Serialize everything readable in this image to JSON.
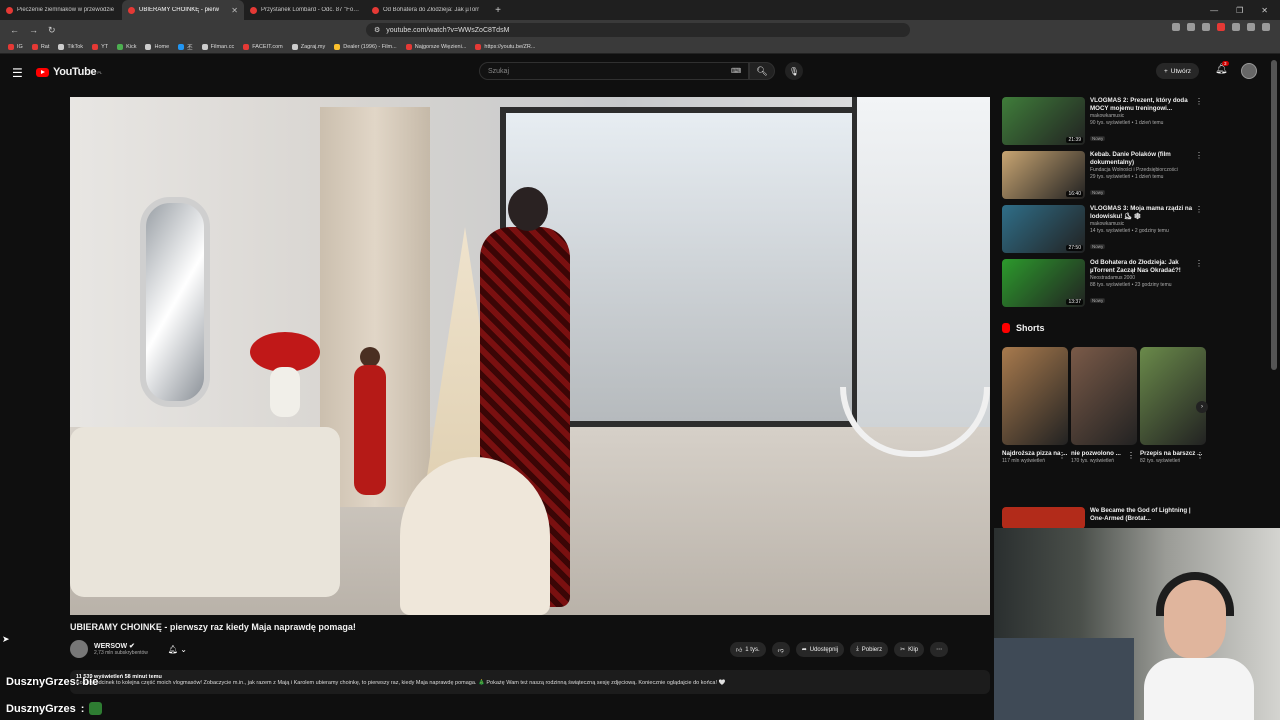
{
  "tabs": [
    {
      "label": "Pieczenie ziemniaków w przewodzie"
    },
    {
      "label": "UBIERAMY CHOINKĘ - pierw"
    },
    {
      "label": "Przystanek Lombard - Odc. 87 \"Forte"
    },
    {
      "label": "Od Bohatera do Złodzieja: Jak µTorr"
    }
  ],
  "browser": {
    "url": "youtube.com/watch?v=WWsZoC8TdsM",
    "bookmarks": [
      "IG",
      "Rat",
      "TikTok",
      "YT",
      "Kick",
      "Home",
      "丕",
      "Filman.cc",
      "FACEIT.com",
      "Zagraj.my",
      "Dealer (1996) - Film...",
      "Najgorsze Więzieni...",
      "https://youtu.be/ZR..."
    ]
  },
  "masthead": {
    "logo": "YouTube",
    "region": "PL",
    "search_placeholder": "Szukaj",
    "create_label": "Utwórz",
    "notif_count": "3"
  },
  "video": {
    "title": "UBIERAMY CHOINKĘ - pierwszy raz kiedy Maja naprawdę pomaga!",
    "channel": "WERSOW",
    "subs": "2,73 mln subskrybentów",
    "likes": "1 tys.",
    "share": "Udostępnij",
    "download": "Pobierz",
    "clip": "Klip",
    "desc_meta": "11 539 wyświetleń  58 minut temu",
    "desc_text": "Kolejny odcinek to kolejna część moich vlogmasów! Zobaczycie m.in., jak razem z Mają i Karolem ubieramy choinkę, to pierwszy raz, kiedy Maja naprawdę pomaga. 🎄 Pokażę Wam też naszą rodzinną świąteczną sesję zdjęciową. Koniecznie oglądajcie do końca! 🤍"
  },
  "chat": [
    {
      "user": "DusznyGrzes",
      "text": ": bie"
    },
    {
      "user": "DusznyGrzes",
      "text": ":"
    }
  ],
  "recommendations": [
    {
      "title": "VLOGMAS 2: Prezent, który doda MOCY mojemu treningowi...",
      "channel": "makowkamusic",
      "views": "90 tys. wyświetleń • 1 dzień temu",
      "badge": "Nowy",
      "duration": "21:39",
      "color": "#3f7d3a"
    },
    {
      "title": "Kebab. Danie Polaków (film dokumentalny)",
      "channel": "Fundacja Wolności i Przedsiębiorczości",
      "views": "29 tys. wyświetleń • 1 dzień temu",
      "badge": "Nowy",
      "duration": "16:40",
      "color": "#c8a572"
    },
    {
      "title": "VLOGMAS 3: Moja mama rządzi na lodowisku! ⛸ ❄",
      "channel": "makowkamusic",
      "views": "14 tys. wyświetleń • 2 godziny temu",
      "badge": "Nowy",
      "duration": "27:50",
      "color": "#2f6e88"
    },
    {
      "title": "Od Bohatera do Złodzieja: Jak µTorrent Zaczął Nas Okradać?!",
      "channel": "Neostradamus 2000",
      "views": "88 tys. wyświetleń • 23 godziny temu",
      "badge": "Nowy",
      "duration": "13:37",
      "color": "#2c9a2c"
    }
  ],
  "shorts_header": "Shorts",
  "shorts": [
    {
      "title": "Najdroższa pizza na ...",
      "views": "117 mln wyświetleń",
      "color": "#a87a4d"
    },
    {
      "title": "nie pozwolono ...",
      "views": "170 tys. wyświetleń",
      "color": "#7a5a48"
    },
    {
      "title": "Przepis na barszcz ...",
      "views": "82 tys. wyświetleń",
      "color": "#6a8a4a"
    }
  ],
  "rec5": {
    "title": "We Became the God of Lightning | One-Armed (Brotat..."
  }
}
